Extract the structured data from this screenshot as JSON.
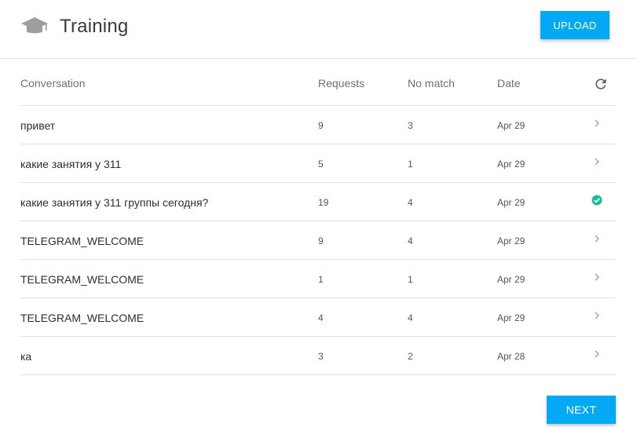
{
  "header": {
    "title": "Training",
    "icon": "graduation-cap-icon",
    "upload_label": "UPLOAD"
  },
  "table": {
    "columns": [
      "Conversation",
      "Requests",
      "No match",
      "Date"
    ],
    "refresh_icon": "refresh-icon",
    "rows": [
      {
        "conversation": "привет",
        "requests": "9",
        "no_match": "3",
        "date": "Apr 29",
        "status": "chevron"
      },
      {
        "conversation": "какие занятия у 311",
        "requests": "5",
        "no_match": "1",
        "date": "Apr 29",
        "status": "chevron"
      },
      {
        "conversation": "какие занятия у 311 группы сегодня?",
        "requests": "19",
        "no_match": "4",
        "date": "Apr 29",
        "status": "check"
      },
      {
        "conversation": "TELEGRAM_WELCOME",
        "requests": "9",
        "no_match": "4",
        "date": "Apr 29",
        "status": "chevron"
      },
      {
        "conversation": "TELEGRAM_WELCOME",
        "requests": "1",
        "no_match": "1",
        "date": "Apr 29",
        "status": "chevron"
      },
      {
        "conversation": "TELEGRAM_WELCOME",
        "requests": "4",
        "no_match": "4",
        "date": "Apr 29",
        "status": "chevron"
      },
      {
        "conversation": "ка",
        "requests": "3",
        "no_match": "2",
        "date": "Apr 28",
        "status": "chevron"
      }
    ]
  },
  "pagination": {
    "next_label": "NEXT"
  },
  "colors": {
    "accent": "#03a9f4",
    "check": "#1abc9c",
    "divider": "#e0e0e0"
  }
}
